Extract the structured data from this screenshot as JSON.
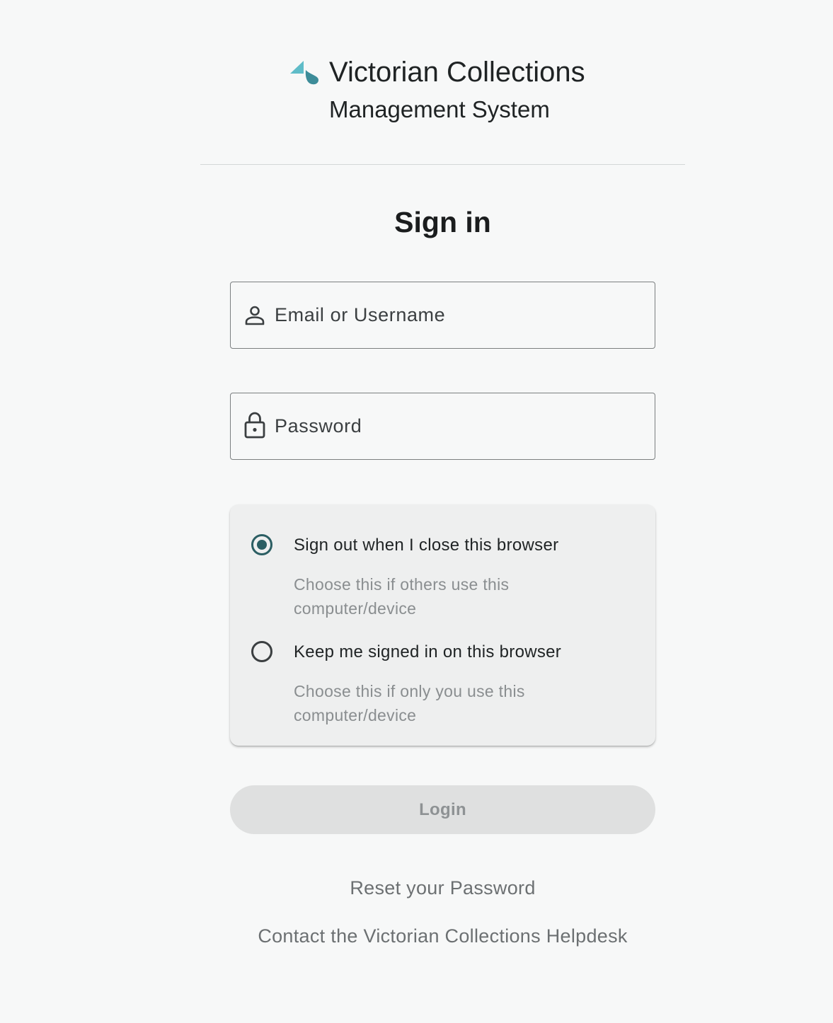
{
  "header": {
    "logo_icon": "victorian-collections-logo",
    "title": "Victorian Collections",
    "subtitle": "Management System"
  },
  "signin": {
    "title": "Sign in"
  },
  "fields": {
    "email": {
      "icon": "person-icon",
      "placeholder": "Email or Username",
      "value": ""
    },
    "password": {
      "icon": "lock-icon",
      "placeholder": "Password",
      "value": ""
    }
  },
  "session_options": [
    {
      "label": "Sign out when I close this browser",
      "help": "Choose this if others use this computer/device",
      "selected": true
    },
    {
      "label": "Keep me signed in on this browser",
      "help": "Choose this if only you use this computer/device",
      "selected": false
    }
  ],
  "login": {
    "label": "Login",
    "disabled": true
  },
  "links": {
    "reset": "Reset your Password",
    "helpdesk": "Contact the Victorian Collections Helpdesk"
  },
  "colors": {
    "background": "#f7f8f8",
    "accent": "#2b5e63",
    "logo_light": "#5fbcc8",
    "logo_dark": "#3d8c99",
    "muted_text": "#8a8e90",
    "disabled_button": "#dfe0e0"
  }
}
